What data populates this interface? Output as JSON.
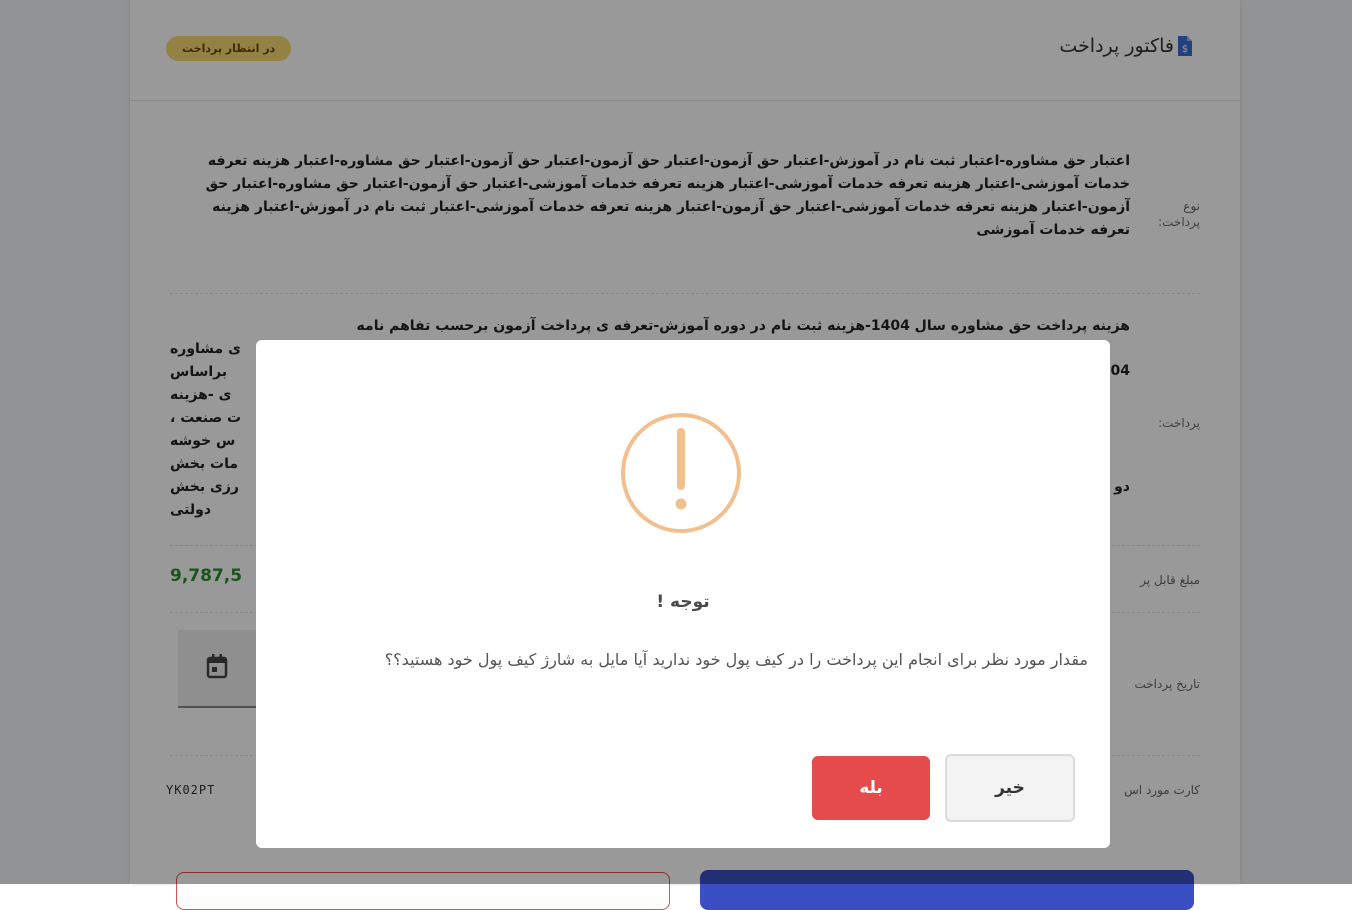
{
  "invoice": {
    "title": "فاکتور پرداخت",
    "status": "در انتظار پرداخت",
    "payment_type_label": "نوع پرداخت:",
    "payment_type_value": "اعتبار حق مشاوره-اعتبار ثبت نام در آموزش-اعتبار حق آزمون-اعتبار حق آزمون-اعتبار حق آزمون-اعتبار حق مشاوره-اعتبار هزینه تعرفه خدمات آموزشی-اعتبار هزینه تعرفه خدمات آموزشی-اعتبار هزینه تعرفه خدمات آموزشی-اعتبار حق آزمون-اعتبار حق مشاوره-اعتبار حق آزمون-اعتبار هزینه تعرفه خدمات آموزشی-اعتبار حق آزمون-اعتبار هزینه تعرفه خدمات آموزشی-اعتبار ثبت نام در آموزش-اعتبار هزینه تعرفه خدمات آموزشی",
    "payment_desc_label": "پرداخت:",
    "payment_desc_lines": [
      "هزینه پرداخت حق مشاوره سال 1404-هزینه ثبت نام در دوره آموزش-تعرفه ی پرداخت آزمون برحسب تفاهم نامه",
      "ی مشاوره",
      "براساس",
      "ی -هزینه",
      "ت صنعت ،",
      "س خوشه",
      "مات بخش",
      "رزی بخش",
      "دولتی"
    ],
    "payment_desc_fragment": "04",
    "payment_desc_fragment_2": "دو",
    "amount_label": "مبلغ قابل پر",
    "amount_value": "9,787,5",
    "date_label": "تاریخ پرداخت",
    "card_label": "کارت مورد اس",
    "card_code": "YK02PT"
  },
  "dialog": {
    "title": "توجه !",
    "message": "مقدار مورد نظر برای انجام این پرداخت را در کیف پول خود ندارید آیا مایل به شارژ کیف پول خود هستید؟؟",
    "no_label": "خیر",
    "yes_label": "بله"
  },
  "colors": {
    "warning": "#f2c08f",
    "confirm": "#e54b4b",
    "status_badge": "#f6d970",
    "amount": "#2e8b2e"
  }
}
